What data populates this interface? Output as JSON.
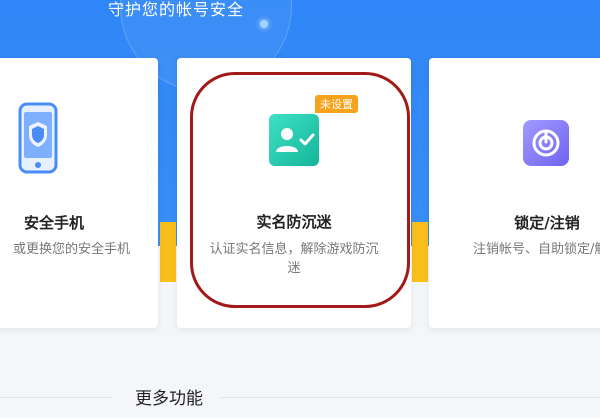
{
  "banner": {
    "subtitle": "守护您的帐号安全"
  },
  "cards": [
    {
      "title": "安全手机",
      "desc": "或更换您的安全手机",
      "icon": "phone-shield-icon"
    },
    {
      "title": "实名防沉迷",
      "desc_line1": "认证实名信息，解除游戏防沉",
      "desc_line2": "迷",
      "badge": "未设置",
      "icon": "id-card-check-icon"
    },
    {
      "title": "锁定/注销",
      "desc": "注销帐号、自助锁定/解",
      "icon": "power-lock-icon"
    }
  ],
  "more": {
    "title": "更多功能"
  },
  "colors": {
    "banner": "#2f86f6",
    "accent_strip": "#fbbf1b",
    "badge": "#f7a21b",
    "highlight": "#a11919"
  }
}
